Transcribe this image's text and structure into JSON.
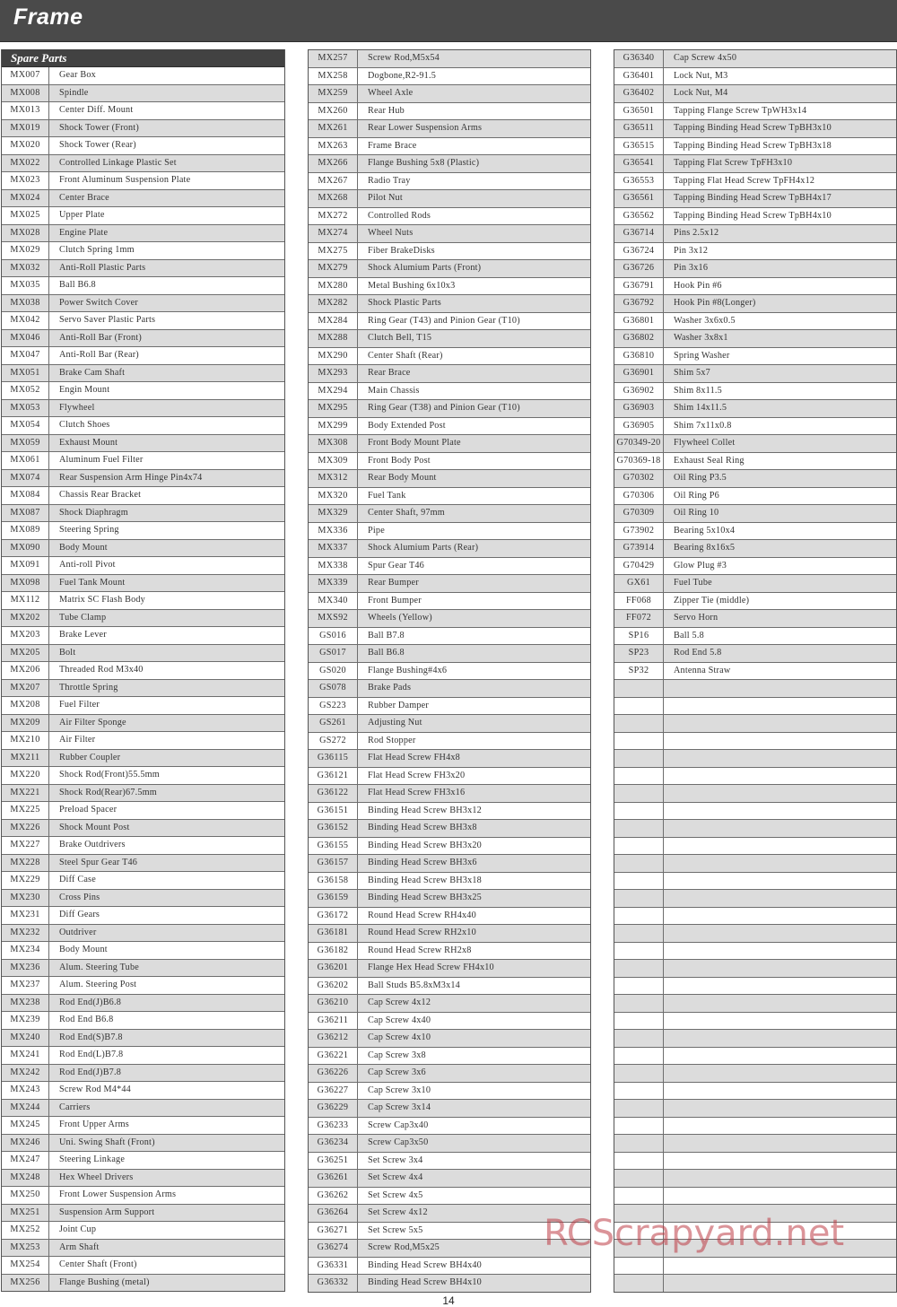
{
  "header": {
    "title": "Frame"
  },
  "section": {
    "title": "Spare Parts"
  },
  "page_number": "14",
  "watermark": "RCScrapyard.net",
  "colors": {
    "header_bg": "#4a4a4a",
    "row_shade": "#dcdcdc",
    "watermark": "#be3c46"
  },
  "columns": [
    {
      "shade_start": 1,
      "rows": [
        {
          "code": "MX007",
          "desc": "Gear Box"
        },
        {
          "code": "MX008",
          "desc": "Spindle"
        },
        {
          "code": "MX013",
          "desc": "Center Diff. Mount"
        },
        {
          "code": "MX019",
          "desc": "Shock Tower (Front)"
        },
        {
          "code": "MX020",
          "desc": "Shock Tower (Rear)"
        },
        {
          "code": "MX022",
          "desc": "Controlled Linkage Plastic Set"
        },
        {
          "code": "MX023",
          "desc": "Front Aluminum Suspension Plate"
        },
        {
          "code": "MX024",
          "desc": "Center Brace"
        },
        {
          "code": "MX025",
          "desc": "Upper Plate"
        },
        {
          "code": "MX028",
          "desc": "Engine Plate"
        },
        {
          "code": "MX029",
          "desc": "Clutch Spring 1mm"
        },
        {
          "code": "MX032",
          "desc": "Anti-Roll Plastic Parts"
        },
        {
          "code": "MX035",
          "desc": "Ball B6.8"
        },
        {
          "code": "MX038",
          "desc": "Power Switch Cover"
        },
        {
          "code": "MX042",
          "desc": "Servo Saver Plastic Parts"
        },
        {
          "code": "MX046",
          "desc": "Anti-Roll Bar (Front)"
        },
        {
          "code": "MX047",
          "desc": "Anti-Roll Bar (Rear)"
        },
        {
          "code": "MX051",
          "desc": "Brake Cam Shaft"
        },
        {
          "code": "MX052",
          "desc": "Engin Mount"
        },
        {
          "code": "MX053",
          "desc": "Flywheel"
        },
        {
          "code": "MX054",
          "desc": "Clutch Shoes"
        },
        {
          "code": "MX059",
          "desc": "Exhaust Mount"
        },
        {
          "code": "MX061",
          "desc": "Aluminum Fuel Filter"
        },
        {
          "code": "MX074",
          "desc": "Rear Suspension Arm Hinge Pin4x74"
        },
        {
          "code": "MX084",
          "desc": "Chassis Rear Bracket"
        },
        {
          "code": "MX087",
          "desc": "Shock Diaphragm"
        },
        {
          "code": "MX089",
          "desc": "Steering Spring"
        },
        {
          "code": "MX090",
          "desc": "Body Mount"
        },
        {
          "code": "MX091",
          "desc": "Anti-roll Pivot"
        },
        {
          "code": "MX098",
          "desc": "Fuel Tank Mount"
        },
        {
          "code": "MX112",
          "desc": "Matrix SC Flash Body"
        },
        {
          "code": "MX202",
          "desc": "Tube Clamp"
        },
        {
          "code": "MX203",
          "desc": "Brake Lever"
        },
        {
          "code": "MX205",
          "desc": "Bolt"
        },
        {
          "code": "MX206",
          "desc": "Threaded Rod M3x40"
        },
        {
          "code": "MX207",
          "desc": "Throttle Spring"
        },
        {
          "code": "MX208",
          "desc": " Fuel Filter"
        },
        {
          "code": "MX209",
          "desc": " Air Filter Sponge"
        },
        {
          "code": "MX210",
          "desc": " Air Filter"
        },
        {
          "code": "MX211",
          "desc": " Rubber Coupler"
        },
        {
          "code": "MX220",
          "desc": " Shock Rod(Front)55.5mm"
        },
        {
          "code": "MX221",
          "desc": " Shock Rod(Rear)67.5mm"
        },
        {
          "code": "MX225",
          "desc": " Preload Spacer"
        },
        {
          "code": "MX226",
          "desc": " Shock Mount Post"
        },
        {
          "code": "MX227",
          "desc": " Brake Outdrivers"
        },
        {
          "code": "MX228",
          "desc": " Steel Spur Gear T46"
        },
        {
          "code": "MX229",
          "desc": " Diff Case"
        },
        {
          "code": "MX230",
          "desc": " Cross Pins"
        },
        {
          "code": "MX231",
          "desc": " Diff Gears"
        },
        {
          "code": "MX232",
          "desc": " Outdriver"
        },
        {
          "code": "MX234",
          "desc": " Body Mount"
        },
        {
          "code": "MX236",
          "desc": " Alum. Steering Tube"
        },
        {
          "code": "MX237",
          "desc": " Alum. Steering Post"
        },
        {
          "code": "MX238",
          "desc": " Rod End(J)B6.8"
        },
        {
          "code": "MX239",
          "desc": " Rod End B6.8"
        },
        {
          "code": "MX240",
          "desc": " Rod End(S)B7.8"
        },
        {
          "code": "MX241",
          "desc": " Rod End(L)B7.8"
        },
        {
          "code": "MX242",
          "desc": " Rod End(J)B7.8"
        },
        {
          "code": "MX243",
          "desc": " Screw Rod M4*44"
        },
        {
          "code": "MX244",
          "desc": " Carriers"
        },
        {
          "code": "MX245",
          "desc": " Front Upper Arms"
        },
        {
          "code": "MX246",
          "desc": " Uni. Swing Shaft (Front)"
        },
        {
          "code": "MX247",
          "desc": " Steering Linkage"
        },
        {
          "code": "MX248",
          "desc": " Hex Wheel Drivers"
        },
        {
          "code": "MX250",
          "desc": " Front Lower Suspension Arms"
        },
        {
          "code": "MX251",
          "desc": " Suspension Arm Support"
        },
        {
          "code": "MX252",
          "desc": " Joint Cup"
        },
        {
          "code": "MX253",
          "desc": " Arm Shaft"
        },
        {
          "code": "MX254",
          "desc": " Center Shaft (Front)"
        },
        {
          "code": "MX256",
          "desc": " Flange Bushing (metal)"
        }
      ]
    },
    {
      "shade_start": 0,
      "rows": [
        {
          "code": "MX257",
          "desc": "Screw Rod,M5x54"
        },
        {
          "code": "MX258",
          "desc": "Dogbone,R2-91.5"
        },
        {
          "code": "MX259",
          "desc": "Wheel Axle"
        },
        {
          "code": "MX260",
          "desc": "Rear Hub"
        },
        {
          "code": "MX261",
          "desc": "Rear Lower Suspension Arms"
        },
        {
          "code": "MX263",
          "desc": "Frame Brace"
        },
        {
          "code": "MX266",
          "desc": "Flange Bushing 5x8 (Plastic)"
        },
        {
          "code": "MX267",
          "desc": " Radio Tray"
        },
        {
          "code": "MX268",
          "desc": "Pilot Nut"
        },
        {
          "code": "MX272",
          "desc": "Controlled Rods"
        },
        {
          "code": "MX274",
          "desc": "Wheel Nuts"
        },
        {
          "code": "MX275",
          "desc": " Fiber BrakeDisks"
        },
        {
          "code": "MX279",
          "desc": "Shock Alumium Parts (Front)"
        },
        {
          "code": "MX280",
          "desc": "Metal Bushing 6x10x3"
        },
        {
          "code": "MX282",
          "desc": "Shock Plastic Parts"
        },
        {
          "code": "MX284",
          "desc": "Ring Gear (T43) and Pinion Gear (T10)"
        },
        {
          "code": "MX288",
          "desc": "Clutch Bell, T15"
        },
        {
          "code": "MX290",
          "desc": "Center Shaft (Rear)"
        },
        {
          "code": "MX293",
          "desc": "Rear Brace"
        },
        {
          "code": "MX294",
          "desc": "Main Chassis"
        },
        {
          "code": "MX295",
          "desc": "Ring Gear (T38) and Pinion Gear (T10)"
        },
        {
          "code": "MX299",
          "desc": "Body Extended Post"
        },
        {
          "code": "MX308",
          "desc": "Front Body Mount Plate"
        },
        {
          "code": "MX309",
          "desc": "Front Body Post"
        },
        {
          "code": "MX312",
          "desc": "Rear Body Mount"
        },
        {
          "code": "MX320",
          "desc": "Fuel Tank"
        },
        {
          "code": "MX329",
          "desc": "Center Shaft, 97mm"
        },
        {
          "code": "MX336",
          "desc": "Pipe"
        },
        {
          "code": "MX337",
          "desc": "Shock Alumium Parts (Rear)"
        },
        {
          "code": "MX338",
          "desc": " Spur Gear T46"
        },
        {
          "code": "MX339",
          "desc": "Rear Bumper"
        },
        {
          "code": "MX340",
          "desc": "Front Bumper"
        },
        {
          "code": "MXS92",
          "desc": "Wheels (Yellow)"
        },
        {
          "code": "GS016",
          "desc": "Ball B7.8"
        },
        {
          "code": "GS017",
          "desc": "Ball B6.8"
        },
        {
          "code": "GS020",
          "desc": "Flange Bushing#4x6"
        },
        {
          "code": "GS078",
          "desc": "Brake Pads"
        },
        {
          "code": "GS223",
          "desc": "Rubber  Damper"
        },
        {
          "code": "GS261",
          "desc": "Adjusting Nut"
        },
        {
          "code": "GS272",
          "desc": "Rod Stopper"
        },
        {
          "code": "G36115",
          "desc": "Flat Head Screw FH4x8"
        },
        {
          "code": "G36121",
          "desc": "Flat Head Screw FH3x20"
        },
        {
          "code": "G36122",
          "desc": "Flat Head Screw FH3x16"
        },
        {
          "code": "G36151",
          "desc": "Binding Head Screw BH3x12"
        },
        {
          "code": "G36152",
          "desc": "Binding Head Screw BH3x8"
        },
        {
          "code": "G36155",
          "desc": "Binding Head Screw BH3x20"
        },
        {
          "code": "G36157",
          "desc": "Binding Head Screw BH3x6"
        },
        {
          "code": "G36158",
          "desc": "Binding Head Screw BH3x18"
        },
        {
          "code": "G36159",
          "desc": "Binding Head Screw BH3x25"
        },
        {
          "code": "G36172",
          "desc": "Round Head Screw RH4x40"
        },
        {
          "code": "G36181",
          "desc": "Round Head Screw RH2x10"
        },
        {
          "code": "G36182",
          "desc": "Round Head Screw RH2x8"
        },
        {
          "code": "G36201",
          "desc": "Flange Hex Head Screw FH4x10"
        },
        {
          "code": "G36202",
          "desc": "Ball Studs B5.8xM3x14"
        },
        {
          "code": "G36210",
          "desc": "Cap Screw 4x12"
        },
        {
          "code": "G36211",
          "desc": "Cap Screw 4x40"
        },
        {
          "code": "G36212",
          "desc": "Cap Screw 4x10"
        },
        {
          "code": "G36221",
          "desc": "Cap Screw 3x8"
        },
        {
          "code": "G36226",
          "desc": "Cap Screw 3x6"
        },
        {
          "code": "G36227",
          "desc": "Cap Screw 3x10"
        },
        {
          "code": "G36229",
          "desc": "Cap Screw 3x14"
        },
        {
          "code": "G36233",
          "desc": "Screw Cap3x40"
        },
        {
          "code": "G36234",
          "desc": "Screw Cap3x50"
        },
        {
          "code": "G36251",
          "desc": "Set Screw 3x4"
        },
        {
          "code": "G36261",
          "desc": "Set Screw 4x4"
        },
        {
          "code": "G36262",
          "desc": "Set Screw 4x5"
        },
        {
          "code": "G36264",
          "desc": "Set Screw 4x12"
        },
        {
          "code": "G36271",
          "desc": "Set Screw 5x5"
        },
        {
          "code": "G36274",
          "desc": "Screw Rod,M5x25"
        },
        {
          "code": "G36331",
          "desc": "Binding Head Screw BH4x40"
        },
        {
          "code": "G36332",
          "desc": "Binding Head Screw BH4x10"
        }
      ]
    },
    {
      "shade_start": 0,
      "rows": [
        {
          "code": "G36340",
          "desc": "Cap Screw 4x50"
        },
        {
          "code": "G36401",
          "desc": "Lock Nut, M3"
        },
        {
          "code": "G36402",
          "desc": "Lock Nut, M4"
        },
        {
          "code": "G36501",
          "desc": "Tapping Flange Screw TpWH3x14"
        },
        {
          "code": "G36511",
          "desc": "Tapping Binding Head Screw TpBH3x10"
        },
        {
          "code": "G36515",
          "desc": "Tapping Binding Head Screw TpBH3x18"
        },
        {
          "code": "G36541",
          "desc": "Tapping Flat Screw TpFH3x10"
        },
        {
          "code": "G36553",
          "desc": "Tapping Flat Head Screw TpFH4x12"
        },
        {
          "code": "G36561",
          "desc": "Tapping Binding Head Screw TpBH4x17"
        },
        {
          "code": "G36562",
          "desc": "Tapping Binding Head Screw TpBH4x10"
        },
        {
          "code": "G36714",
          "desc": "Pins 2.5x12"
        },
        {
          "code": "G36724",
          "desc": "Pin 3x12"
        },
        {
          "code": "G36726",
          "desc": "Pin 3x16"
        },
        {
          "code": "G36791",
          "desc": "Hook Pin #6"
        },
        {
          "code": "G36792",
          "desc": "Hook Pin #8(Longer)"
        },
        {
          "code": "G36801",
          "desc": "Washer 3x6x0.5"
        },
        {
          "code": "G36802",
          "desc": "Washer 3x8x1"
        },
        {
          "code": "G36810",
          "desc": " Spring Washer"
        },
        {
          "code": "G36901",
          "desc": "Shim 5x7"
        },
        {
          "code": "G36902",
          "desc": "Shim 8x11.5"
        },
        {
          "code": "G36903",
          "desc": "Shim 14x11.5"
        },
        {
          "code": "G36905",
          "desc": "Shim 7x11x0.8"
        },
        {
          "code": "G70349-20",
          "desc": "Flywheel Collet"
        },
        {
          "code": "G70369-18",
          "desc": "Exhaust Seal Ring"
        },
        {
          "code": "G70302",
          "desc": "Oil Ring P3.5"
        },
        {
          "code": "G70306",
          "desc": "Oil Ring P6"
        },
        {
          "code": "G70309",
          "desc": "Oil Ring 10"
        },
        {
          "code": "G73902",
          "desc": "Bearing 5x10x4"
        },
        {
          "code": "G73914",
          "desc": "Bearing 8x16x5"
        },
        {
          "code": "G70429",
          "desc": "Glow Plug #3"
        },
        {
          "code": "GX61",
          "desc": " Fuel Tube"
        },
        {
          "code": "FF068",
          "desc": " Zipper Tie (middle)"
        },
        {
          "code": "FF072",
          "desc": " Servo Horn"
        },
        {
          "code": "SP16",
          "desc": "Ball 5.8"
        },
        {
          "code": "SP23",
          "desc": "Rod End 5.8"
        },
        {
          "code": "SP32",
          "desc": "Antenna Straw"
        },
        {
          "code": "",
          "desc": ""
        },
        {
          "code": "",
          "desc": ""
        },
        {
          "code": "",
          "desc": ""
        },
        {
          "code": "",
          "desc": ""
        },
        {
          "code": "",
          "desc": ""
        },
        {
          "code": "",
          "desc": ""
        },
        {
          "code": "",
          "desc": ""
        },
        {
          "code": "",
          "desc": ""
        },
        {
          "code": "",
          "desc": ""
        },
        {
          "code": "",
          "desc": ""
        },
        {
          "code": "",
          "desc": ""
        },
        {
          "code": "",
          "desc": ""
        },
        {
          "code": "",
          "desc": ""
        },
        {
          "code": "",
          "desc": ""
        },
        {
          "code": "",
          "desc": ""
        },
        {
          "code": "",
          "desc": ""
        },
        {
          "code": "",
          "desc": ""
        },
        {
          "code": "",
          "desc": ""
        },
        {
          "code": "",
          "desc": ""
        },
        {
          "code": "",
          "desc": ""
        },
        {
          "code": "",
          "desc": ""
        },
        {
          "code": "",
          "desc": ""
        },
        {
          "code": "",
          "desc": ""
        },
        {
          "code": "",
          "desc": ""
        },
        {
          "code": "",
          "desc": ""
        },
        {
          "code": "",
          "desc": ""
        },
        {
          "code": "",
          "desc": ""
        },
        {
          "code": "",
          "desc": ""
        },
        {
          "code": "",
          "desc": ""
        },
        {
          "code": "",
          "desc": ""
        },
        {
          "code": "",
          "desc": ""
        },
        {
          "code": "",
          "desc": ""
        },
        {
          "code": "",
          "desc": ""
        },
        {
          "code": "",
          "desc": ""
        },
        {
          "code": "",
          "desc": ""
        }
      ]
    }
  ]
}
